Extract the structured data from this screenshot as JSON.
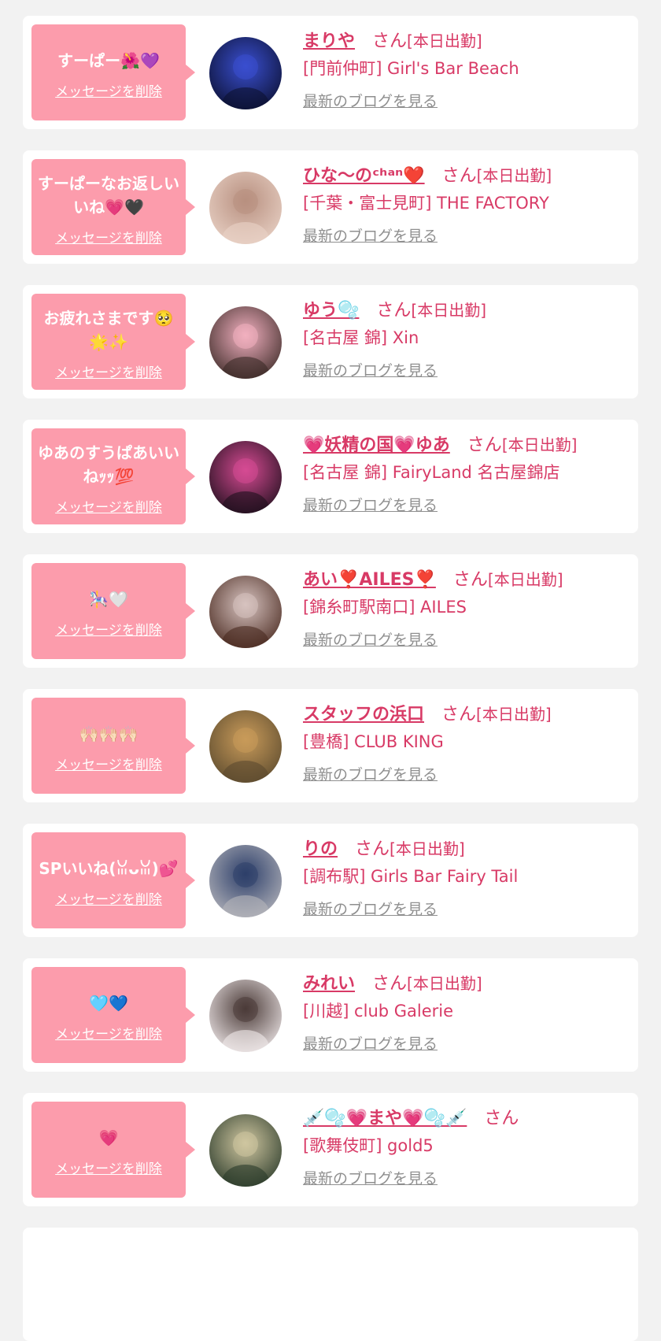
{
  "labels": {
    "delete": "メッセージを削除",
    "san": "さん",
    "blog": "最新のブログを見る"
  },
  "colors": {
    "bubble": "#fc9cac",
    "name": "#d83a66",
    "link_gray": "#8f8f8f",
    "card_bg": "#ffffff",
    "page_bg": "#f2f2f2"
  },
  "items": [
    {
      "message": "すーぱー🌺💜",
      "name": "まりや",
      "attendance": "[本日出勤]",
      "shop": "[門前仲町] Girl's Bar Beach",
      "avatar_colors": [
        "#0b1030",
        "#3a4fd0"
      ]
    },
    {
      "message": "すーぱーなお返しいいね💗🖤",
      "name": "ひな〜のᶜʰᵃⁿ❤️",
      "attendance": "[本日出勤]",
      "shop": "[千葉・富士見町] THE FACTORY",
      "avatar_colors": [
        "#e9d2c6",
        "#b89080"
      ]
    },
    {
      "message": "お疲れさまです🥺🌟✨",
      "name": "ゆう🫧",
      "attendance": "[本日出勤]",
      "shop": "[名古屋 錦] Xin",
      "avatar_colors": [
        "#3b2a26",
        "#f2b0c0"
      ]
    },
    {
      "message": "ゆあのすうぱあいいねｯｯ💯",
      "name": "💗妖精の国💗ゆあ",
      "attendance": "[本日出勤]",
      "shop": "[名古屋 錦] FairyLand 名古屋錦店",
      "avatar_colors": [
        "#1e0f1c",
        "#d64b93"
      ]
    },
    {
      "message": "🎠🤍",
      "name": "あい❣️AILES❣️",
      "attendance": "[本日出勤]",
      "shop": "[錦糸町駅南口] AILES",
      "avatar_colors": [
        "#4a2a20",
        "#d7c3c0"
      ]
    },
    {
      "message": "🙌🏻🙌🏻🙌🏻",
      "name": "スタッフの浜口",
      "attendance": "[本日出勤]",
      "shop": "[豊橋] CLUB KING",
      "avatar_colors": [
        "#5b4a2e",
        "#c99b5a"
      ]
    },
    {
      "message": "SPいいね(ꈍᴗꈍ)💕",
      "name": "りの",
      "attendance": "[本日出勤]",
      "shop": "[調布駅] Girls Bar Fairy Tail",
      "avatar_colors": [
        "#b5b5bb",
        "#2d3f6a"
      ]
    },
    {
      "message": "🩵💙",
      "name": "みれい",
      "attendance": "[本日出勤]",
      "shop": "[川越] club Galerie",
      "avatar_colors": [
        "#f0e9ea",
        "#4b3b38"
      ]
    },
    {
      "message": "💗",
      "name": "💉🫧💗まや💗🫧💉",
      "attendance": "",
      "shop": "[歌舞伎町] gold5",
      "avatar_colors": [
        "#2a3a2a",
        "#cfc6a0"
      ]
    }
  ]
}
